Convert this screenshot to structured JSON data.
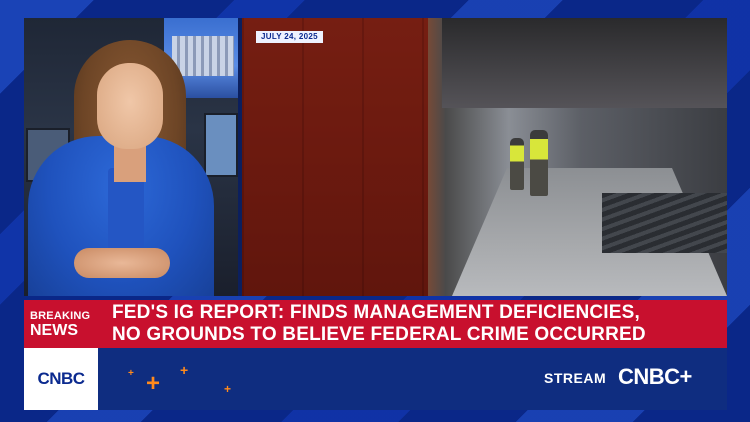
{
  "video": {
    "date_tag": "JULY 24, 2025"
  },
  "lower_third": {
    "breaking_line1": "BREAKING",
    "breaking_line2": "NEWS",
    "headline_line1": "FED'S IG REPORT: FINDS MANAGEMENT DEFICIENCIES,",
    "headline_line2": "NO GROUNDS TO BELIEVE FEDERAL CRIME OCCURRED",
    "accent_color": "#c8102e"
  },
  "bottom_bar": {
    "network_logo": "CNBC",
    "stream_label": "STREAM",
    "stream_brand": "CNBC+",
    "plus_color": "#ff8a1c"
  }
}
